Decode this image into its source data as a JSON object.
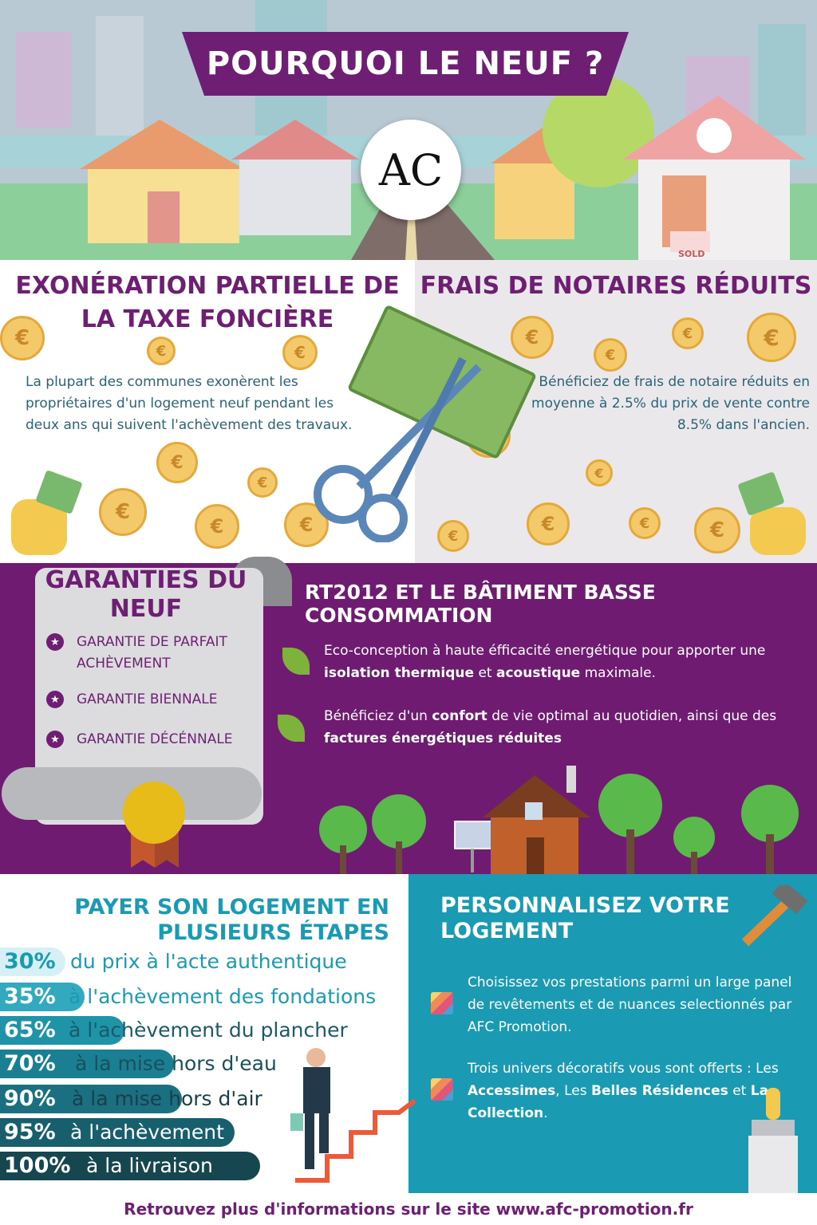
{
  "hero": {
    "title": "POURQUOI LE NEUF ?",
    "logo_text": "AC",
    "sold_sign": "SOLD"
  },
  "tax": {
    "title": "EXONÉRATION PARTIELLE DE LA TAXE FONCIÈRE",
    "text": "La plupart des communes exonèrent les propriétaires d'un logement neuf pendant les deux ans qui suivent l'achèvement des travaux."
  },
  "notary": {
    "title": "FRAIS DE NOTAIRES RÉDUITS",
    "text": "Bénéficiez de frais de notaire réduits en moyenne à 2.5% du prix de vente contre 8.5% dans l'ancien."
  },
  "coin_symbol": "€",
  "guarantees": {
    "title": "GARANTIES DU NEUF",
    "items": [
      "GARANTIE DE PARFAIT ACHÈVEMENT",
      "GARANTIE BIENNALE",
      "GARANTIE DÉCÉNNALE"
    ],
    "star_glyph": "★"
  },
  "rt2012": {
    "title": "RT2012 ET LE BÂTIMENT  BASSE CONSOMMATION",
    "item1": {
      "a": "Eco-conception à haute éfficacité energétique pour apporter une ",
      "b": "isolation thermique",
      "c": " et ",
      "d": "acoustique",
      "e": " maximale."
    },
    "item2": {
      "a": "Bénéficiez d'un ",
      "b": "confort",
      "c": " de vie optimal au quotidien, ainsi que des ",
      "d": "factures énergétiques réduites",
      "e": ""
    }
  },
  "payment": {
    "title": "PAYER SON LOGEMENT EN PLUSIEURS ÉTAPES",
    "steps": [
      {
        "pct": "30%",
        "text": "du prix à l'acte authentique"
      },
      {
        "pct": "35%",
        "text": "à l'achèvement des fondations"
      },
      {
        "pct": "65%",
        "text": "à l'achèvement du plancher"
      },
      {
        "pct": "70%",
        "text": "à la mise hors d'eau"
      },
      {
        "pct": "90%",
        "text": "à la mise hors d'air"
      },
      {
        "pct": "95%",
        "text": "à l'achèvement"
      },
      {
        "pct": "100%",
        "text": "à la livraison"
      }
    ]
  },
  "personalize": {
    "title": "PERSONNALISEZ VOTRE LOGEMENT",
    "item1": "Choisissez vos prestations parmi un large panel de revêtements et de nuances selectionnés par AFC Promotion.",
    "item2": {
      "a": "Trois univers décoratifs vous sont offerts : Les ",
      "b": "Accessimes",
      "c": ", Les ",
      "d": "Belles Résidences",
      "e": " et ",
      "f": "La Collection",
      "g": "."
    }
  },
  "footer": "Retrouvez plus d'informations sur le site www.afc-promotion.fr",
  "colors": {
    "purple": "#6e1f74",
    "teal": "#1a9bb3",
    "coin": "#f3c969"
  }
}
